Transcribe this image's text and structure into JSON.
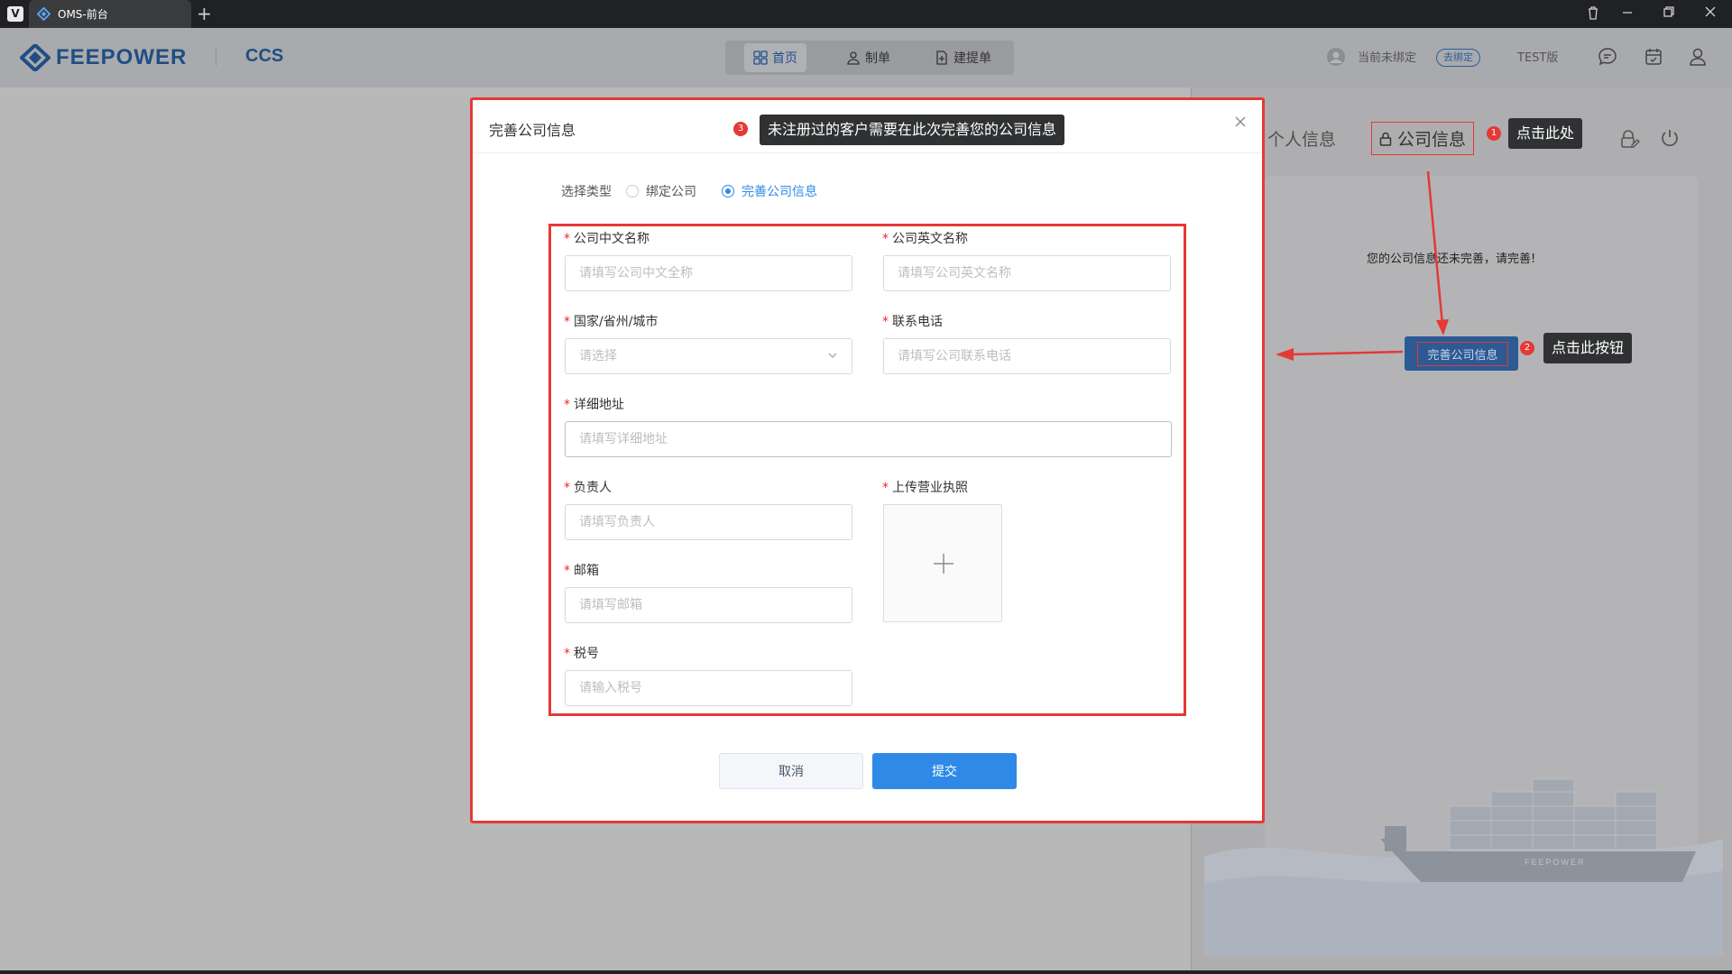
{
  "browser": {
    "tab_title": "OMS-前台",
    "new_tab": "+"
  },
  "header": {
    "logo_text": "FEEPOWER",
    "logo_sub": "CCS",
    "nav": [
      {
        "label": "首页",
        "active": true
      },
      {
        "label": "制单",
        "active": false
      },
      {
        "label": "建提单",
        "active": false
      }
    ],
    "bind_status": "当前未绑定",
    "bind_button": "去绑定",
    "version": "TEST版"
  },
  "right_panel": {
    "tab_personal": "个人信息",
    "tab_company": "公司信息",
    "message": "您的公司信息还未完善，请完善!",
    "complete_button": "完善公司信息",
    "ship_text": "FEEPOWER"
  },
  "callouts": [
    {
      "num": "1",
      "text": "点击此处"
    },
    {
      "num": "2",
      "text": "点击此按钮"
    },
    {
      "num": "3",
      "text": "未注册过的客户需要在此次完善您的公司信息"
    }
  ],
  "dialog": {
    "title": "完善公司信息",
    "type_label": "选择类型",
    "type_options": [
      {
        "label": "绑定公司",
        "checked": false
      },
      {
        "label": "完善公司信息",
        "checked": true
      }
    ],
    "fields": {
      "cn_name": {
        "label": "公司中文名称",
        "placeholder": "请填写公司中文全称"
      },
      "en_name": {
        "label": "公司英文名称",
        "placeholder": "请填写公司英文名称"
      },
      "region": {
        "label": "国家/省州/城市",
        "placeholder": "请选择"
      },
      "phone": {
        "label": "联系电话",
        "placeholder": "请填写公司联系电话"
      },
      "address": {
        "label": "详细地址",
        "placeholder": "请填写详细地址"
      },
      "person": {
        "label": "负责人",
        "placeholder": "请填写负责人"
      },
      "license": {
        "label": "上传营业执照"
      },
      "email": {
        "label": "邮箱",
        "placeholder": "请填写邮箱"
      },
      "tax": {
        "label": "税号",
        "placeholder": "请输入税号"
      }
    },
    "required_mark": "*",
    "cancel": "取消",
    "submit": "提交"
  },
  "colors": {
    "accent": "#2e8ae6",
    "brand": "#1f4e84",
    "annotation": "#e53935"
  }
}
